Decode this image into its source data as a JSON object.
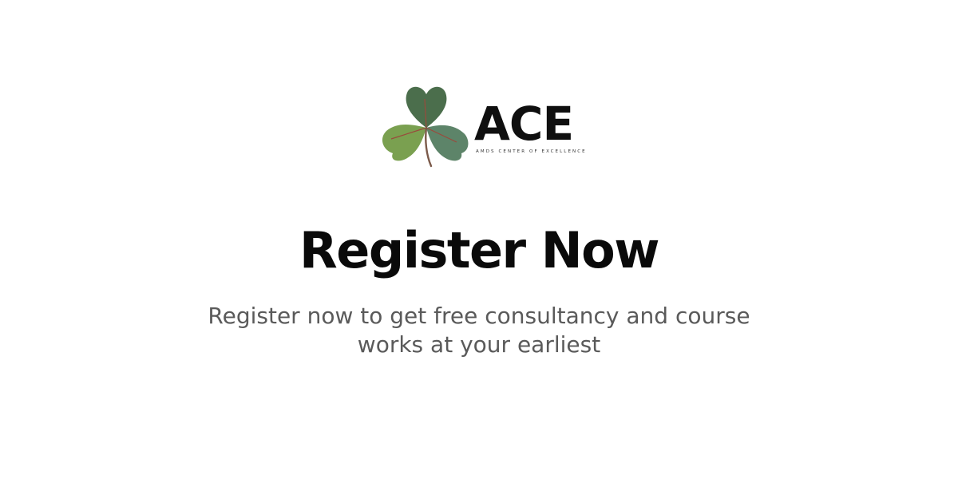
{
  "logo": {
    "wordmark": "ACE",
    "tagline": "AMDS CENTER OF EXCELLENCE",
    "icon": "shamrock-icon",
    "colors": {
      "leaf_top": "#4b6e4c",
      "leaf_left": "#7aa050",
      "leaf_right": "#5d8469",
      "vein": "#9a4a3c"
    }
  },
  "hero": {
    "title": "Register Now",
    "subtitle": "Register now to get free consultancy and course works at your earliest"
  },
  "colors": {
    "background": "#ffffff",
    "title": "#0a0a0a",
    "subtitle": "#5a5a5a"
  }
}
